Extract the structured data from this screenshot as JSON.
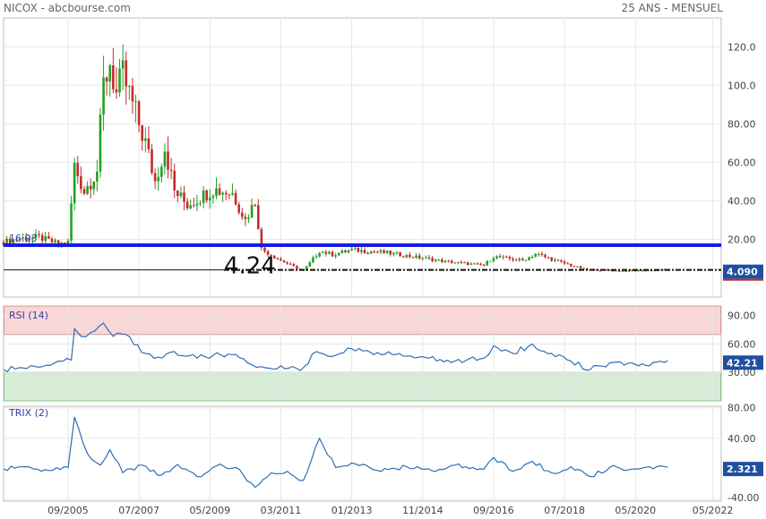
{
  "header": {
    "title": "NICOX - abcbourse.com",
    "period": "25 ANS - MENSUEL"
  },
  "colors": {
    "up": "#23a023",
    "down": "#c42b2b",
    "rsi": "#2f6eb5",
    "trix": "#2f6eb5",
    "support": "#1a1ae6",
    "badge": "#1f4fa0",
    "rsi_over": "#f8d7d7",
    "rsi_under": "#d6ecd6"
  },
  "chart_data": [
    {
      "type": "candlestick",
      "title": "NICOX - abcbourse.com",
      "timeframe": "25 ANS - MENSUEL",
      "x_tick_labels": [
        "09/2005",
        "07/2007",
        "05/2009",
        "03/2011",
        "01/2013",
        "11/2014",
        "09/2016",
        "07/2018",
        "05/2020",
        "05/2022"
      ],
      "y_tick_labels": [
        "20.00",
        "40.00",
        "60.00",
        "80.00",
        "100.0",
        "120.0"
      ],
      "ylim": [
        -10,
        135
      ],
      "last_value_label": "4.090",
      "horizontal_line_value": 16.93,
      "horizontal_line_label": "16.93",
      "annotation": "4.24",
      "annotation_value": 4.24,
      "series_close": [
        {
          "x": "2004-01",
          "y": 18.5
        },
        {
          "x": "2004-06",
          "y": 20.5
        },
        {
          "x": "2004-12",
          "y": 21.0
        },
        {
          "x": "2005-06",
          "y": 17.5
        },
        {
          "x": "2005-09",
          "y": 18.5
        },
        {
          "x": "2005-11",
          "y": 58.0
        },
        {
          "x": "2006-02",
          "y": 45.0
        },
        {
          "x": "2006-06",
          "y": 56.0
        },
        {
          "x": "2006-08",
          "y": 100.0
        },
        {
          "x": "2006-10",
          "y": 112.0
        },
        {
          "x": "2006-12",
          "y": 95.0
        },
        {
          "x": "2007-02",
          "y": 105.0
        },
        {
          "x": "2007-05",
          "y": 90.0
        },
        {
          "x": "2007-09",
          "y": 70.0
        },
        {
          "x": "2007-12",
          "y": 50.0
        },
        {
          "x": "2008-03",
          "y": 68.0
        },
        {
          "x": "2008-06",
          "y": 45.0
        },
        {
          "x": "2008-10",
          "y": 38.0
        },
        {
          "x": "2009-02",
          "y": 42.0
        },
        {
          "x": "2009-06",
          "y": 46.0
        },
        {
          "x": "2009-12",
          "y": 44.0
        },
        {
          "x": "2010-04",
          "y": 30.0
        },
        {
          "x": "2010-07",
          "y": 40.0
        },
        {
          "x": "2010-09",
          "y": 15.0
        },
        {
          "x": "2011-03",
          "y": 9.0
        },
        {
          "x": "2011-10",
          "y": 3.5
        },
        {
          "x": "2012-03",
          "y": 14.0
        },
        {
          "x": "2012-07",
          "y": 12.0
        },
        {
          "x": "2013-01",
          "y": 14.5
        },
        {
          "x": "2013-12",
          "y": 13.0
        },
        {
          "x": "2014-06",
          "y": 11.5
        },
        {
          "x": "2015-06",
          "y": 8.5
        },
        {
          "x": "2016-06",
          "y": 6.5
        },
        {
          "x": "2016-09",
          "y": 11.0
        },
        {
          "x": "2017-06",
          "y": 9.0
        },
        {
          "x": "2017-10",
          "y": 12.5
        },
        {
          "x": "2018-06",
          "y": 8.0
        },
        {
          "x": "2019-01",
          "y": 4.5
        },
        {
          "x": "2020-01",
          "y": 3.5
        },
        {
          "x": "2021-03",
          "y": 4.09
        }
      ]
    },
    {
      "type": "line",
      "title": "RSI (14)",
      "x_tick_labels": [
        "09/2005",
        "07/2007",
        "05/2009",
        "03/2011",
        "01/2013",
        "11/2014",
        "09/2016",
        "07/2018",
        "05/2020",
        "05/2022"
      ],
      "y_tick_labels": [
        "30.00",
        "60.00",
        "90.00"
      ],
      "ylim": [
        0,
        100
      ],
      "levels": {
        "overbought": 70,
        "oversold": 30
      },
      "last_value_label": "42.21",
      "series": [
        {
          "name": "RSI (14)",
          "points": [
            {
              "x": "2004-01",
              "y": 33
            },
            {
              "x": "2005-01",
              "y": 36
            },
            {
              "x": "2005-06",
              "y": 42
            },
            {
              "x": "2005-10",
              "y": 43
            },
            {
              "x": "2005-11",
              "y": 76
            },
            {
              "x": "2006-01",
              "y": 68
            },
            {
              "x": "2006-04",
              "y": 72
            },
            {
              "x": "2006-08",
              "y": 82
            },
            {
              "x": "2006-11",
              "y": 68
            },
            {
              "x": "2007-03",
              "y": 70
            },
            {
              "x": "2007-09",
              "y": 50
            },
            {
              "x": "2008-01",
              "y": 46
            },
            {
              "x": "2008-06",
              "y": 52
            },
            {
              "x": "2009-01",
              "y": 45
            },
            {
              "x": "2009-06",
              "y": 48
            },
            {
              "x": "2010-01",
              "y": 49
            },
            {
              "x": "2010-06",
              "y": 38
            },
            {
              "x": "2010-09",
              "y": 36
            },
            {
              "x": "2011-03",
              "y": 37
            },
            {
              "x": "2011-09",
              "y": 32
            },
            {
              "x": "2012-02",
              "y": 52
            },
            {
              "x": "2012-08",
              "y": 48
            },
            {
              "x": "2013-01",
              "y": 55
            },
            {
              "x": "2013-09",
              "y": 51
            },
            {
              "x": "2014-06",
              "y": 47
            },
            {
              "x": "2015-01",
              "y": 45
            },
            {
              "x": "2015-09",
              "y": 42
            },
            {
              "x": "2016-06",
              "y": 45
            },
            {
              "x": "2016-09",
              "y": 58
            },
            {
              "x": "2017-03",
              "y": 50
            },
            {
              "x": "2017-09",
              "y": 60
            },
            {
              "x": "2018-03",
              "y": 50
            },
            {
              "x": "2018-09",
              "y": 42
            },
            {
              "x": "2019-03",
              "y": 33
            },
            {
              "x": "2019-09",
              "y": 40
            },
            {
              "x": "2020-06",
              "y": 37
            },
            {
              "x": "2021-03",
              "y": 42.21
            }
          ]
        }
      ]
    },
    {
      "type": "line",
      "title": "TRIX (2)",
      "x_tick_labels": [
        "09/2005",
        "07/2007",
        "05/2009",
        "03/2011",
        "01/2013",
        "11/2014",
        "09/2016",
        "07/2018",
        "05/2020",
        "05/2022"
      ],
      "y_tick_labels": [
        "-40.00",
        "40.00",
        "80.00"
      ],
      "ylim": [
        -42,
        82
      ],
      "last_value_label": "2.321",
      "series": [
        {
          "name": "TRIX (2)",
          "points": [
            {
              "x": "2004-01",
              "y": 0
            },
            {
              "x": "2004-08",
              "y": 3
            },
            {
              "x": "2005-03",
              "y": -2
            },
            {
              "x": "2005-09",
              "y": 2
            },
            {
              "x": "2005-11",
              "y": 68
            },
            {
              "x": "2006-03",
              "y": 20
            },
            {
              "x": "2006-07",
              "y": 5
            },
            {
              "x": "2006-10",
              "y": 25
            },
            {
              "x": "2007-02",
              "y": -5
            },
            {
              "x": "2007-08",
              "y": 5
            },
            {
              "x": "2008-02",
              "y": -8
            },
            {
              "x": "2008-07",
              "y": 6
            },
            {
              "x": "2009-01",
              "y": -10
            },
            {
              "x": "2009-07",
              "y": 4
            },
            {
              "x": "2010-01",
              "y": 2
            },
            {
              "x": "2010-07",
              "y": -24
            },
            {
              "x": "2010-12",
              "y": -5
            },
            {
              "x": "2011-05",
              "y": -3
            },
            {
              "x": "2011-10",
              "y": -15
            },
            {
              "x": "2012-03",
              "y": 40
            },
            {
              "x": "2012-08",
              "y": 2
            },
            {
              "x": "2013-01",
              "y": 8
            },
            {
              "x": "2013-09",
              "y": -2
            },
            {
              "x": "2014-06",
              "y": 3
            },
            {
              "x": "2015-03",
              "y": -3
            },
            {
              "x": "2015-09",
              "y": 5
            },
            {
              "x": "2016-06",
              "y": 0
            },
            {
              "x": "2016-09",
              "y": 15
            },
            {
              "x": "2017-03",
              "y": -3
            },
            {
              "x": "2017-09",
              "y": 10
            },
            {
              "x": "2018-03",
              "y": -5
            },
            {
              "x": "2018-09",
              "y": 3
            },
            {
              "x": "2019-03",
              "y": -10
            },
            {
              "x": "2019-09",
              "y": 2
            },
            {
              "x": "2020-06",
              "y": 0
            },
            {
              "x": "2021-03",
              "y": 2.321
            }
          ]
        }
      ]
    }
  ]
}
